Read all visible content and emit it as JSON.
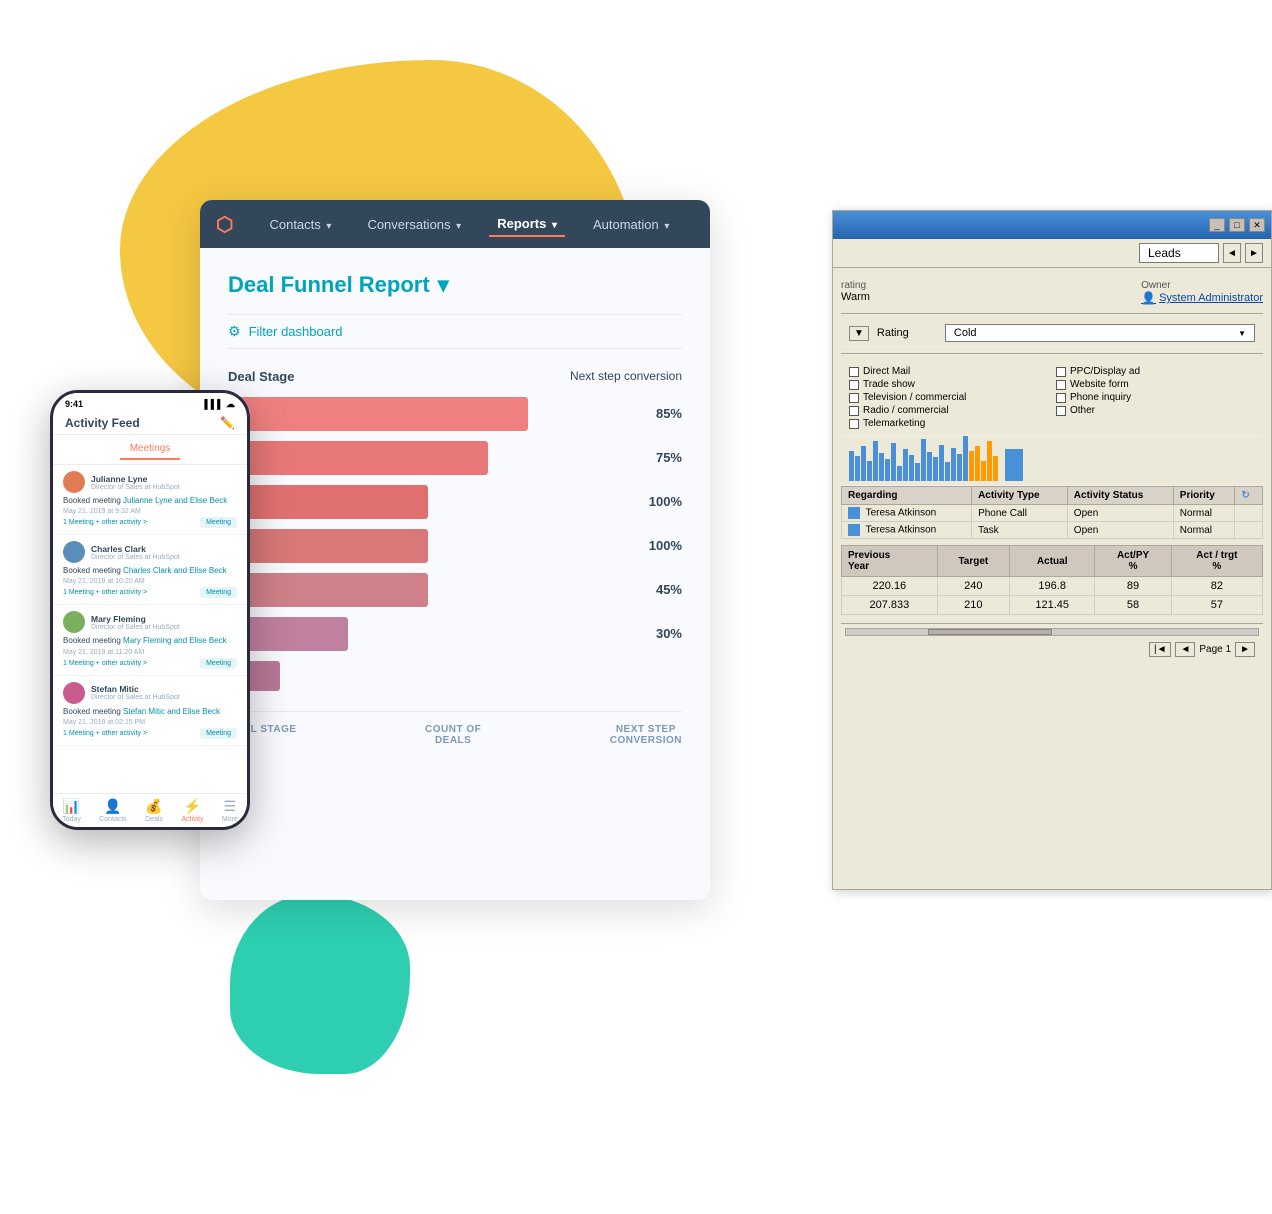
{
  "background": {
    "blob_colors": [
      "#F5C842",
      "#2ECFB1"
    ]
  },
  "hubspot": {
    "logo": "⬡",
    "nav_items": [
      {
        "label": "Contacts",
        "has_arrow": true,
        "active": false
      },
      {
        "label": "Conversations",
        "has_arrow": true,
        "active": false
      },
      {
        "label": "Reports",
        "has_arrow": true,
        "active": true
      },
      {
        "label": "Automation",
        "has_arrow": true,
        "active": false
      }
    ],
    "report_title": "Deal Funnel Report",
    "filter_label": "Filter dashboard",
    "chart": {
      "deal_stage_label": "Deal Stage",
      "next_step_label": "Next step conversion",
      "bars": [
        {
          "value": 80,
          "pct": "85%",
          "color": "#F08080",
          "width": "75%"
        },
        {
          "value": 68,
          "pct": "75%",
          "color": "#E87878",
          "width": "65%"
        },
        {
          "value": 51,
          "pct": "100%",
          "color": "#E07070",
          "width": "50%"
        },
        {
          "value": 51,
          "pct": "100%",
          "color": "#D87878",
          "width": "50%"
        },
        {
          "value": 51,
          "pct": "45%",
          "color": "#CF8088",
          "width": "50%"
        },
        {
          "value": 23,
          "pct": "30%",
          "color": "#C080A0",
          "width": "30%"
        },
        {
          "value": 7,
          "pct": "",
          "color": "#B87898",
          "width": "8%"
        }
      ],
      "footer_cols": [
        "Deal Stage",
        "Count of Deals",
        "Next Step Conversion"
      ]
    }
  },
  "phone": {
    "time": "9:41",
    "signal": "▌▌▌ ☁",
    "title": "Activity Feed",
    "tabs": [
      "Meetings"
    ],
    "feed_items": [
      {
        "name": "Julianne Lyne",
        "role": "Director of Sales at HubSpot",
        "text_prefix": "Booked meeting ",
        "text_link": "Julianne Lyne and Elise Beck",
        "date": "May 21, 2019 at 9:32 AM",
        "action_link": "1 Meeting + other activity",
        "badge": "Meeting"
      },
      {
        "name": "Charles Clark",
        "role": "Director of Sales at HubSpot",
        "text_prefix": "Booked meeting ",
        "text_link": "Charles Clark and Elise Beck",
        "date": "May 21, 2019 at 10:20 AM",
        "action_link": "1 Meeting + other activity",
        "badge": "Meeting"
      },
      {
        "name": "Mary Fleming",
        "role": "Director of Sales at HubSpot",
        "text_prefix": "Booked meeting ",
        "text_link": "Mary Fleming and Elise Beck",
        "date": "May 21, 2019 at 11:20 AM",
        "action_link": "1 Meeting + other activity",
        "badge": "Meeting"
      },
      {
        "name": "Stefan Mitic",
        "role": "Director of Sales at HubSpot",
        "text_prefix": "Booked meeting ",
        "text_link": "Stefan Mitic and Elise Beck",
        "date": "May 21, 2019 at 02:15 PM",
        "action_link": "1 Meeting + other activity",
        "badge": "Meeting"
      }
    ],
    "nav_items": [
      {
        "icon": "📊",
        "label": "Today"
      },
      {
        "icon": "👤",
        "label": "Contacts"
      },
      {
        "icon": "💰",
        "label": "Deals"
      },
      {
        "icon": "⚡",
        "label": "Activity",
        "active": true
      },
      {
        "icon": "⋯",
        "label": "More"
      }
    ]
  },
  "crm": {
    "title": "Leads",
    "win_buttons": [
      "_",
      "□",
      "✕"
    ],
    "fields": {
      "rating_label": "rating",
      "rating_value": "Warm",
      "owner_label": "Owner",
      "owner_value": "System Administrator",
      "dropdown_label": "Rating",
      "dropdown_value": "Cold"
    },
    "checkboxes": [
      {
        "label": "Direct Mail",
        "checked": false
      },
      {
        "label": "PPC/Display ad",
        "checked": false
      },
      {
        "label": "Trade show",
        "checked": false
      },
      {
        "label": "Website form",
        "checked": false
      },
      {
        "label": "Television / commercial",
        "checked": false
      },
      {
        "label": "Phone inquiry",
        "checked": false
      },
      {
        "label": "Radio / commercial",
        "checked": false
      },
      {
        "label": "Other",
        "checked": false
      },
      {
        "label": "Telemarketing",
        "checked": false
      }
    ],
    "activities_table": {
      "headers": [
        "Regarding",
        "Activity Type",
        "Activity Status",
        "Priority",
        "↻"
      ],
      "rows": [
        {
          "regarding": "Teresa Atkinson",
          "activity_type": "Phone Call",
          "status": "Open",
          "priority": "Normal"
        },
        {
          "regarding": "Teresa Atkinson",
          "activity_type": "Task",
          "status": "Open",
          "priority": "Normal"
        }
      ]
    },
    "finance_table": {
      "headers": [
        "Previous Year",
        "Target",
        "Actual",
        "Act/PY %",
        "Act / trgt %"
      ],
      "rows": [
        {
          "prev_year": "220.16",
          "target": "240",
          "actual": "196.8",
          "act_py": "89",
          "act_trgt": "82"
        },
        {
          "prev_year": "207.833",
          "target": "210",
          "actual": "121.45",
          "act_py": "58",
          "act_trgt": "57"
        }
      ]
    },
    "pagination": "◄ Page 1 ►"
  }
}
